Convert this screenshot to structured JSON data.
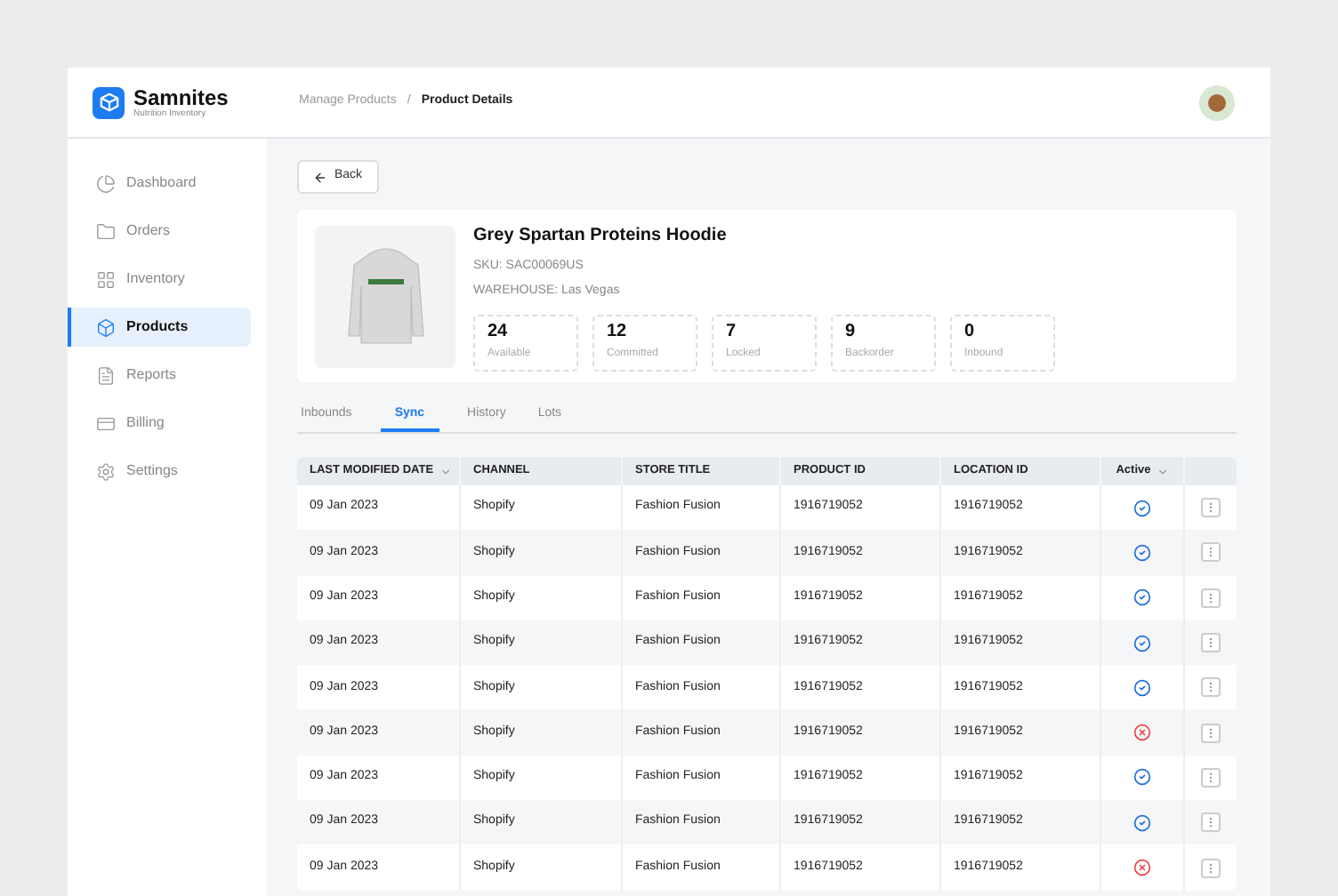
{
  "brand": {
    "name": "Samnites",
    "tagline": "Nutrition Inventory"
  },
  "breadcrumb": [
    {
      "label": "Manage Products",
      "current": false
    },
    {
      "label": "/",
      "current": false
    },
    {
      "label": "Product Details",
      "current": true
    }
  ],
  "sidebar": {
    "items": [
      {
        "label": "Dashboard",
        "selected": false
      },
      {
        "label": "Orders",
        "selected": false
      },
      {
        "label": "Inventory",
        "selected": false
      },
      {
        "label": "Products",
        "selected": true
      },
      {
        "label": "Reports",
        "selected": false
      },
      {
        "label": "Billing",
        "selected": false
      },
      {
        "label": "Settings",
        "selected": false
      }
    ]
  },
  "back_button": "Back",
  "product": {
    "name": "Grey Spartan Proteins Hoodie",
    "sku": "SKU: SAC00069US",
    "warehouse": "WAREHOUSE: Las Vegas",
    "stats": [
      {
        "value": "24",
        "label": "Available"
      },
      {
        "value": "12",
        "label": "Committed"
      },
      {
        "value": "7",
        "label": "Locked"
      },
      {
        "value": "9",
        "label": "Backorder"
      },
      {
        "value": "0",
        "label": "Inbound"
      }
    ]
  },
  "tabs": [
    {
      "label": "Inbounds",
      "selected": false
    },
    {
      "label": "Sync",
      "selected": true
    },
    {
      "label": "History",
      "selected": false
    },
    {
      "label": "Lots",
      "selected": false
    }
  ],
  "table": {
    "columns": [
      {
        "label": "LAST MODIFIED DATE",
        "sortable": true
      },
      {
        "label": "CHANNEL",
        "sortable": false
      },
      {
        "label": "STORE TITLE",
        "sortable": false
      },
      {
        "label": "PRODUCT ID",
        "sortable": false
      },
      {
        "label": "LOCATION ID",
        "sortable": false
      },
      {
        "label": "Active",
        "sortable": true
      }
    ],
    "rows": [
      {
        "date": "09 Jan 2023",
        "channel": "Shopify",
        "store_title": "Fashion Fusion",
        "product_id": "1916719052",
        "location_id": "1916719052",
        "active": true
      },
      {
        "date": "09 Jan 2023",
        "channel": "Shopify",
        "store_title": "Fashion Fusion",
        "product_id": "1916719052",
        "location_id": "1916719052",
        "active": true
      },
      {
        "date": "09 Jan 2023",
        "channel": "Shopify",
        "store_title": "Fashion Fusion",
        "product_id": "1916719052",
        "location_id": "1916719052",
        "active": true
      },
      {
        "date": "09 Jan 2023",
        "channel": "Shopify",
        "store_title": "Fashion Fusion",
        "product_id": "1916719052",
        "location_id": "1916719052",
        "active": true
      },
      {
        "date": "09 Jan 2023",
        "channel": "Shopify",
        "store_title": "Fashion Fusion",
        "product_id": "1916719052",
        "location_id": "1916719052",
        "active": true
      },
      {
        "date": "09 Jan 2023",
        "channel": "Shopify",
        "store_title": "Fashion Fusion",
        "product_id": "1916719052",
        "location_id": "1916719052",
        "active": false
      },
      {
        "date": "09 Jan 2023",
        "channel": "Shopify",
        "store_title": "Fashion Fusion",
        "product_id": "1916719052",
        "location_id": "1916719052",
        "active": true
      },
      {
        "date": "09 Jan 2023",
        "channel": "Shopify",
        "store_title": "Fashion Fusion",
        "product_id": "1916719052",
        "location_id": "1916719052",
        "active": true
      },
      {
        "date": "09 Jan 2023",
        "channel": "Shopify",
        "store_title": "Fashion Fusion",
        "product_id": "1916719052",
        "location_id": "1916719052",
        "active": false
      }
    ]
  }
}
